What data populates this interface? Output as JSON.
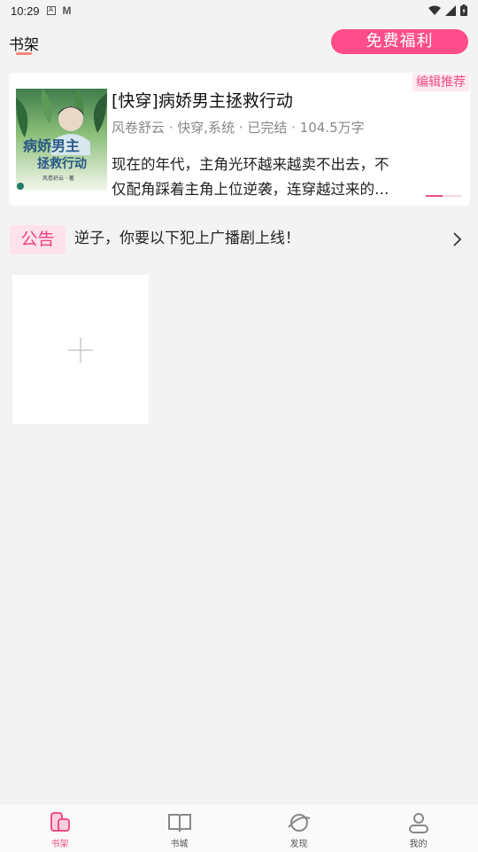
{
  "status_bar": {
    "time": "10:29",
    "notif_a": "A",
    "notif_m": "M"
  },
  "header": {
    "title": "书架",
    "free_button": "免费福利"
  },
  "recommend": {
    "badge": "编辑推荐",
    "title": "[快穿]病娇男主拯救行动",
    "meta": "风卷舒云 · 快穿,系统 · 已完结 · 104.5万字",
    "desc_line1": "现在的年代，主角光环越来越卖不出去，不",
    "desc_line2": "仅配角踩着主角上位逆袭，连穿越过来的…",
    "cover_title": "病娇男主拯救行动",
    "cover_author": "风卷舒云 · 著"
  },
  "notice": {
    "tag": "公告",
    "text": "逆子，你要以下犯上广播剧上线！"
  },
  "add_tile": {
    "icon": "plus-icon"
  },
  "tabs": [
    {
      "label": "书架",
      "icon": "bookshelf-icon",
      "active": true
    },
    {
      "label": "书城",
      "icon": "book-open-icon",
      "active": false
    },
    {
      "label": "发现",
      "icon": "planet-icon",
      "active": false
    },
    {
      "label": "我的",
      "icon": "person-icon",
      "active": false
    }
  ],
  "colors": {
    "accent": "#ff4c8b",
    "badge_bg": "#fde9ef",
    "background": "#f3f3f3"
  }
}
